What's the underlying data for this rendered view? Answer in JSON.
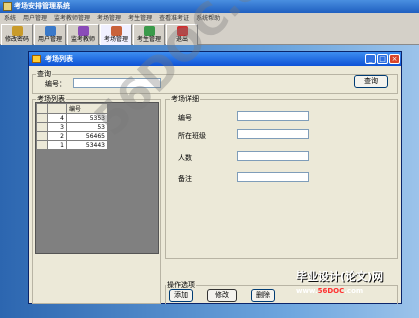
{
  "app": {
    "title": "考场安排管理系统",
    "menu": [
      "系统",
      "用户管理",
      "监考教师管理",
      "考场管理",
      "考生管理",
      "查看准考证",
      "系统帮助"
    ],
    "toolbar": [
      {
        "label": "修改密码",
        "icon": "key-icon",
        "color": "#c99b2a"
      },
      {
        "label": "用户管理",
        "icon": "users-icon",
        "color": "#3a79c9"
      },
      {
        "label": "监考教师",
        "icon": "teacher-icon",
        "color": "#8a4bb8"
      },
      {
        "label": "考场管理",
        "icon": "room-icon",
        "color": "#c9623a"
      },
      {
        "label": "考生管理",
        "icon": "students-icon",
        "color": "#3a9a4a"
      },
      {
        "label": "退出",
        "icon": "exit-icon",
        "color": "#d03030"
      }
    ]
  },
  "dialog": {
    "title": "考场列表",
    "query": {
      "group": "查询",
      "id_label": "编号：",
      "id_value": "",
      "button": "查询"
    },
    "list": {
      "group": "考场列表",
      "header": "编号",
      "rows": [
        {
          "index": "4",
          "id": "5353"
        },
        {
          "index": "3",
          "id": "53"
        },
        {
          "index": "2",
          "id": "56465"
        },
        {
          "index": "1",
          "id": "53443"
        }
      ]
    },
    "detail": {
      "group": "考场详细",
      "fields": [
        {
          "label": "编号",
          "value": ""
        },
        {
          "label": "所在班级",
          "value": ""
        },
        {
          "label": "人数",
          "value": ""
        },
        {
          "label": "备注",
          "value": ""
        }
      ]
    },
    "ops": {
      "group": "操作选项",
      "add": "添加",
      "edit": "修改",
      "delete": "删除"
    }
  },
  "watermark": "56DOC.com",
  "branding": {
    "title": "毕业设计(论文)网",
    "url_prefix": "www.",
    "url_red": "56DOC",
    "url_suffix": ".com"
  }
}
